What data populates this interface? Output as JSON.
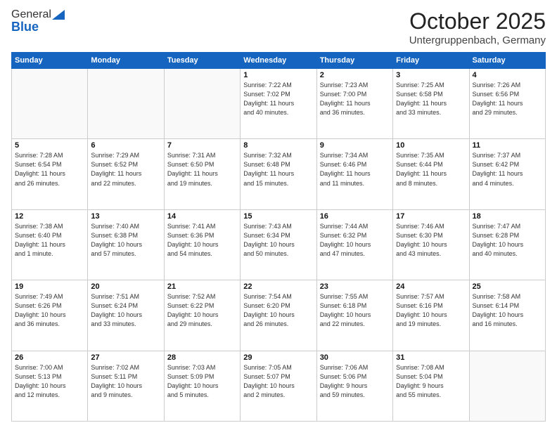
{
  "header": {
    "logo_general": "General",
    "logo_blue": "Blue",
    "month_title": "October 2025",
    "location": "Untergruppenbach, Germany"
  },
  "weekdays": [
    "Sunday",
    "Monday",
    "Tuesday",
    "Wednesday",
    "Thursday",
    "Friday",
    "Saturday"
  ],
  "weeks": [
    [
      {
        "day": "",
        "detail": ""
      },
      {
        "day": "",
        "detail": ""
      },
      {
        "day": "",
        "detail": ""
      },
      {
        "day": "1",
        "detail": "Sunrise: 7:22 AM\nSunset: 7:02 PM\nDaylight: 11 hours\nand 40 minutes."
      },
      {
        "day": "2",
        "detail": "Sunrise: 7:23 AM\nSunset: 7:00 PM\nDaylight: 11 hours\nand 36 minutes."
      },
      {
        "day": "3",
        "detail": "Sunrise: 7:25 AM\nSunset: 6:58 PM\nDaylight: 11 hours\nand 33 minutes."
      },
      {
        "day": "4",
        "detail": "Sunrise: 7:26 AM\nSunset: 6:56 PM\nDaylight: 11 hours\nand 29 minutes."
      }
    ],
    [
      {
        "day": "5",
        "detail": "Sunrise: 7:28 AM\nSunset: 6:54 PM\nDaylight: 11 hours\nand 26 minutes."
      },
      {
        "day": "6",
        "detail": "Sunrise: 7:29 AM\nSunset: 6:52 PM\nDaylight: 11 hours\nand 22 minutes."
      },
      {
        "day": "7",
        "detail": "Sunrise: 7:31 AM\nSunset: 6:50 PM\nDaylight: 11 hours\nand 19 minutes."
      },
      {
        "day": "8",
        "detail": "Sunrise: 7:32 AM\nSunset: 6:48 PM\nDaylight: 11 hours\nand 15 minutes."
      },
      {
        "day": "9",
        "detail": "Sunrise: 7:34 AM\nSunset: 6:46 PM\nDaylight: 11 hours\nand 11 minutes."
      },
      {
        "day": "10",
        "detail": "Sunrise: 7:35 AM\nSunset: 6:44 PM\nDaylight: 11 hours\nand 8 minutes."
      },
      {
        "day": "11",
        "detail": "Sunrise: 7:37 AM\nSunset: 6:42 PM\nDaylight: 11 hours\nand 4 minutes."
      }
    ],
    [
      {
        "day": "12",
        "detail": "Sunrise: 7:38 AM\nSunset: 6:40 PM\nDaylight: 11 hours\nand 1 minute."
      },
      {
        "day": "13",
        "detail": "Sunrise: 7:40 AM\nSunset: 6:38 PM\nDaylight: 10 hours\nand 57 minutes."
      },
      {
        "day": "14",
        "detail": "Sunrise: 7:41 AM\nSunset: 6:36 PM\nDaylight: 10 hours\nand 54 minutes."
      },
      {
        "day": "15",
        "detail": "Sunrise: 7:43 AM\nSunset: 6:34 PM\nDaylight: 10 hours\nand 50 minutes."
      },
      {
        "day": "16",
        "detail": "Sunrise: 7:44 AM\nSunset: 6:32 PM\nDaylight: 10 hours\nand 47 minutes."
      },
      {
        "day": "17",
        "detail": "Sunrise: 7:46 AM\nSunset: 6:30 PM\nDaylight: 10 hours\nand 43 minutes."
      },
      {
        "day": "18",
        "detail": "Sunrise: 7:47 AM\nSunset: 6:28 PM\nDaylight: 10 hours\nand 40 minutes."
      }
    ],
    [
      {
        "day": "19",
        "detail": "Sunrise: 7:49 AM\nSunset: 6:26 PM\nDaylight: 10 hours\nand 36 minutes."
      },
      {
        "day": "20",
        "detail": "Sunrise: 7:51 AM\nSunset: 6:24 PM\nDaylight: 10 hours\nand 33 minutes."
      },
      {
        "day": "21",
        "detail": "Sunrise: 7:52 AM\nSunset: 6:22 PM\nDaylight: 10 hours\nand 29 minutes."
      },
      {
        "day": "22",
        "detail": "Sunrise: 7:54 AM\nSunset: 6:20 PM\nDaylight: 10 hours\nand 26 minutes."
      },
      {
        "day": "23",
        "detail": "Sunrise: 7:55 AM\nSunset: 6:18 PM\nDaylight: 10 hours\nand 22 minutes."
      },
      {
        "day": "24",
        "detail": "Sunrise: 7:57 AM\nSunset: 6:16 PM\nDaylight: 10 hours\nand 19 minutes."
      },
      {
        "day": "25",
        "detail": "Sunrise: 7:58 AM\nSunset: 6:14 PM\nDaylight: 10 hours\nand 16 minutes."
      }
    ],
    [
      {
        "day": "26",
        "detail": "Sunrise: 7:00 AM\nSunset: 5:13 PM\nDaylight: 10 hours\nand 12 minutes."
      },
      {
        "day": "27",
        "detail": "Sunrise: 7:02 AM\nSunset: 5:11 PM\nDaylight: 10 hours\nand 9 minutes."
      },
      {
        "day": "28",
        "detail": "Sunrise: 7:03 AM\nSunset: 5:09 PM\nDaylight: 10 hours\nand 5 minutes."
      },
      {
        "day": "29",
        "detail": "Sunrise: 7:05 AM\nSunset: 5:07 PM\nDaylight: 10 hours\nand 2 minutes."
      },
      {
        "day": "30",
        "detail": "Sunrise: 7:06 AM\nSunset: 5:06 PM\nDaylight: 9 hours\nand 59 minutes."
      },
      {
        "day": "31",
        "detail": "Sunrise: 7:08 AM\nSunset: 5:04 PM\nDaylight: 9 hours\nand 55 minutes."
      },
      {
        "day": "",
        "detail": ""
      }
    ]
  ]
}
